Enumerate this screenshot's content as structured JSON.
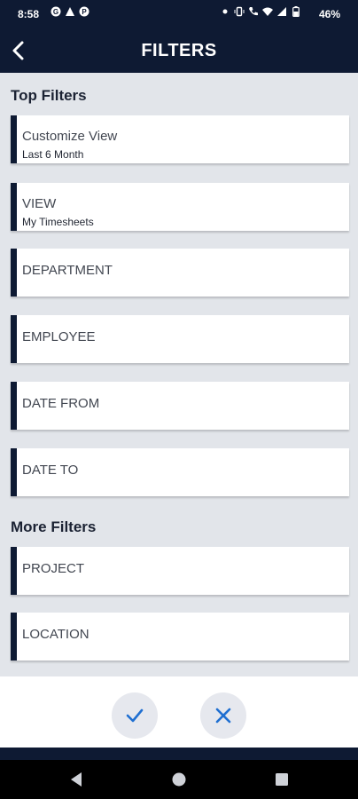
{
  "status_bar": {
    "time": "8:58",
    "battery": "46%",
    "left_icons": [
      "g-icon",
      "warning-icon",
      "p-icon"
    ],
    "right_icons": [
      "dot-icon",
      "vibrate-icon",
      "call-icon",
      "wifi-icon",
      "signal-icon",
      "battery-icon"
    ]
  },
  "header": {
    "title": "FILTERS",
    "back_icon": "chevron-left-icon",
    "background": "#0e1a33"
  },
  "sections": [
    {
      "title": "Top Filters",
      "items": [
        {
          "label": "Customize View",
          "value": "Last 6 Month"
        },
        {
          "label": "VIEW",
          "value": "My Timesheets"
        },
        {
          "label": "DEPARTMENT"
        },
        {
          "label": "EMPLOYEE"
        },
        {
          "label": "DATE FROM"
        },
        {
          "label": "DATE TO"
        }
      ]
    },
    {
      "title": "More Filters",
      "items": [
        {
          "label": "PROJECT"
        },
        {
          "label": "LOCATION"
        }
      ]
    }
  ],
  "actions": {
    "apply_icon": "check-icon",
    "cancel_icon": "close-icon",
    "accent": "#1f6fd1"
  },
  "nav": {
    "back": "back-triangle-icon",
    "home": "home-circle-icon",
    "recents": "recents-square-icon"
  }
}
